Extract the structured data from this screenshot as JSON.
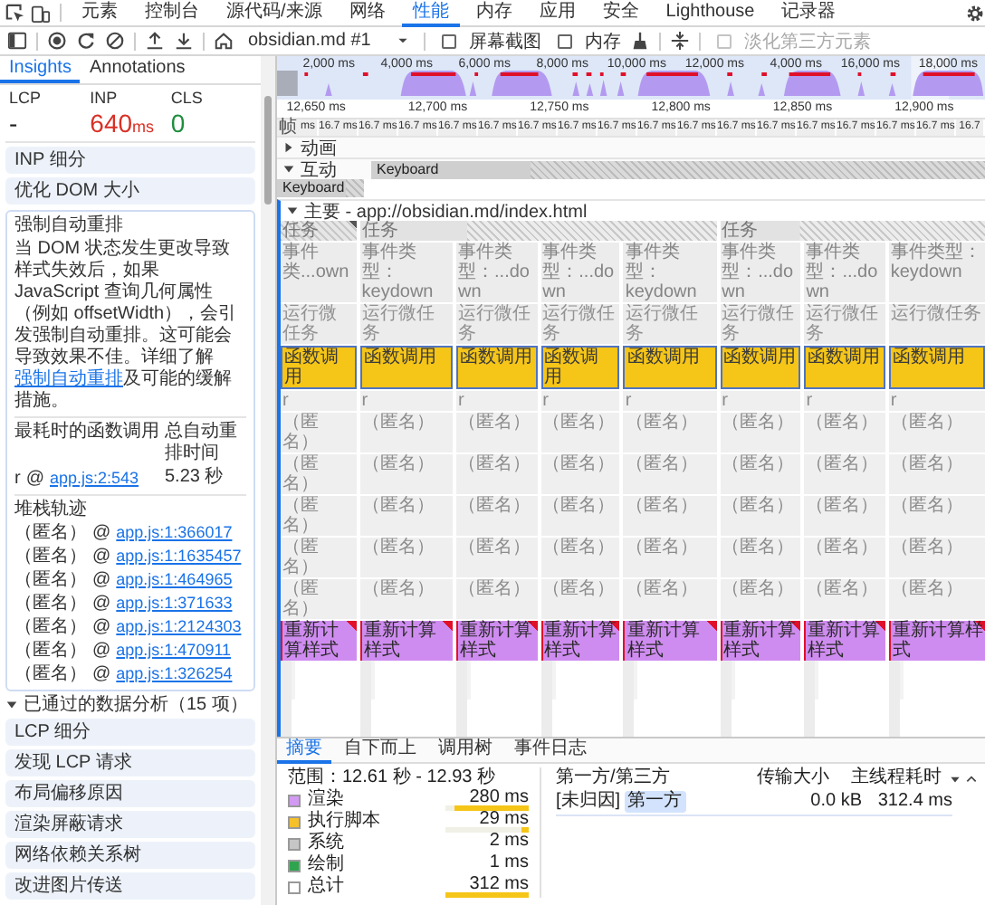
{
  "devtools_tabs": [
    {
      "label": "元素",
      "selected": false
    },
    {
      "label": "控制台",
      "selected": false
    },
    {
      "label": "源代码/来源",
      "selected": false
    },
    {
      "label": "网络",
      "selected": false
    },
    {
      "label": "性能",
      "selected": true
    },
    {
      "label": "内存",
      "selected": false
    },
    {
      "label": "应用",
      "selected": false
    },
    {
      "label": "安全",
      "selected": false
    },
    {
      "label": "Lighthouse",
      "selected": false
    },
    {
      "label": "记录器",
      "selected": false
    }
  ],
  "toolbar": {
    "target": "obsidian.md #1",
    "checkboxes": [
      {
        "label": "屏幕截图",
        "checked": false,
        "disabled": false
      },
      {
        "label": "内存",
        "checked": false,
        "disabled": false
      },
      {
        "label": "淡化第三方元素",
        "checked": false,
        "disabled": true
      }
    ]
  },
  "sidebar": {
    "tabs": [
      {
        "label": "Insights",
        "selected": true
      },
      {
        "label": "Annotations",
        "selected": false
      }
    ],
    "metrics": [
      {
        "name": "LCP",
        "value": "-",
        "color": "#1f1f1f"
      },
      {
        "name": "INP",
        "value": "640",
        "unit": "ms",
        "color": "#d93025"
      },
      {
        "name": "CLS",
        "value": "0",
        "color": "#1e8e3e"
      }
    ],
    "insights": [
      {
        "title": "INP 细分"
      },
      {
        "title": "优化 DOM 大小"
      }
    ],
    "expanded_insight": {
      "title": "强制自动重排",
      "description_before": "当 DOM 状态发生更改导致样式失效后，如果 JavaScript 查询几何属性（例如 offsetWidth），会引发强制自动重排。这可能会导致效果不佳。详细了解",
      "link": "强制自动重排",
      "description_after": "及可能的缓解措施。",
      "columns": [
        "最耗时的函数调用",
        "总自动重排时间"
      ],
      "top_call": {
        "function": "r",
        "at": "@",
        "source": "app.js:2:543",
        "time": "5.23 秒"
      },
      "stack_title": "堆栈轨迹",
      "stack": [
        {
          "function": "（匿名）",
          "at": "@",
          "source": "app.js:1:366017"
        },
        {
          "function": "（匿名）",
          "at": "@",
          "source": "app.js:1:1635457"
        },
        {
          "function": "（匿名）",
          "at": "@",
          "source": "app.js:1:464965"
        },
        {
          "function": "（匿名）",
          "at": "@",
          "source": "app.js:1:371633"
        },
        {
          "function": "（匿名）",
          "at": "@",
          "source": "app.js:1:2124303"
        },
        {
          "function": "（匿名）",
          "at": "@",
          "source": "app.js:1:470911"
        },
        {
          "function": "（匿名）",
          "at": "@",
          "source": "app.js:1:326254"
        }
      ]
    },
    "passed_section": {
      "title": "已通过的数据分析（15 项）",
      "expanded": true,
      "items": [
        {
          "title": "LCP 细分"
        },
        {
          "title": "发现 LCP 请求"
        },
        {
          "title": "布局偏移原因"
        },
        {
          "title": "渲染屏蔽请求"
        },
        {
          "title": "网络依赖关系树"
        },
        {
          "title": "改进图片传送"
        }
      ]
    }
  },
  "timeline": {
    "overview_ticks": [
      "2,000 ms",
      "4,000 ms",
      "6,000 ms",
      "8,000 ms",
      "10,000 ms",
      "12,000 ms",
      "4,000 ms",
      "16,000 ms",
      "18,000 ms"
    ],
    "ruler_ticks": [
      "12,650 ms",
      "12,700 ms",
      "12,750 ms",
      "12,800 ms",
      "12,850 ms",
      "12,900 ms"
    ],
    "frames": {
      "label": "帧",
      "items": [
        "ms",
        "16.7 ms",
        "16.7 ms",
        "16.7 ms",
        "16.7 ms",
        "16.7 ms",
        "16.7 ms",
        "16.7 ms",
        "16.7 ms",
        "16.7 ms",
        "16.7 ms",
        "16.7 ms",
        "16.7 ms",
        "16.7 ms",
        "16.7 ms",
        "16.7 ms",
        "16.7 ms",
        "16.7"
      ]
    },
    "animations": {
      "label": "动画",
      "expanded": false
    },
    "interactions": {
      "label": "互动",
      "expanded": true,
      "items": [
        {
          "label": "Keyboard"
        },
        {
          "label": "Keyboard"
        }
      ]
    },
    "main": {
      "title": "主要 - app://obsidian.md/index.html",
      "expanded": true,
      "tasks": [
        {
          "label": "任务",
          "events": [
            {
              "label": "事件类...own",
              "frames": [
                {
                  "kind": "microtask",
                  "label": "运行微任务"
                },
                {
                  "kind": "function",
                  "label": "函数调用"
                },
                {
                  "kind": "plain",
                  "label": "r"
                },
                {
                  "kind": "plain",
                  "label": "（匿名）"
                },
                {
                  "kind": "plain",
                  "label": "（匿名）"
                },
                {
                  "kind": "plain",
                  "label": "（匿名）"
                },
                {
                  "kind": "plain",
                  "label": "（匿名）"
                },
                {
                  "kind": "plain",
                  "label": "（匿名）"
                },
                {
                  "kind": "style",
                  "label": "重新计算样式"
                }
              ]
            }
          ]
        },
        {
          "label": "任务",
          "events": [
            {
              "label": "事件类型：keydown",
              "frames": [
                {
                  "kind": "microtask",
                  "label": "运行微任务"
                },
                {
                  "kind": "function",
                  "label": "函数调用"
                },
                {
                  "kind": "plain",
                  "label": "r"
                },
                {
                  "kind": "plain",
                  "label": "（匿名）"
                },
                {
                  "kind": "plain",
                  "label": "（匿名）"
                },
                {
                  "kind": "plain",
                  "label": "（匿名）"
                },
                {
                  "kind": "plain",
                  "label": "（匿名）"
                },
                {
                  "kind": "plain",
                  "label": "（匿名）"
                },
                {
                  "kind": "style",
                  "label": "重新计算样式"
                }
              ]
            },
            {
              "label": "事件类型：...down",
              "frames": [
                {
                  "kind": "microtask",
                  "label": "运行微任务"
                },
                {
                  "kind": "function",
                  "label": "函数调用"
                },
                {
                  "kind": "plain",
                  "label": "r"
                },
                {
                  "kind": "plain",
                  "label": "（匿名）"
                },
                {
                  "kind": "plain",
                  "label": "（匿名）"
                },
                {
                  "kind": "plain",
                  "label": "（匿名）"
                },
                {
                  "kind": "plain",
                  "label": "（匿名）"
                },
                {
                  "kind": "plain",
                  "label": "（匿名）"
                },
                {
                  "kind": "style",
                  "label": "重新计算样式"
                }
              ]
            },
            {
              "label": "事件类型：...down",
              "frames": [
                {
                  "kind": "microtask",
                  "label": "运行微任务"
                },
                {
                  "kind": "function",
                  "label": "函数调用"
                },
                {
                  "kind": "plain",
                  "label": "r"
                },
                {
                  "kind": "plain",
                  "label": "（匿名）"
                },
                {
                  "kind": "plain",
                  "label": "（匿名）"
                },
                {
                  "kind": "plain",
                  "label": "（匿名）"
                },
                {
                  "kind": "plain",
                  "label": "（匿名）"
                },
                {
                  "kind": "plain",
                  "label": "（匿名）"
                },
                {
                  "kind": "style",
                  "label": "重新计算样式"
                }
              ]
            },
            {
              "label": "事件类型：keydown",
              "frames": [
                {
                  "kind": "microtask",
                  "label": "运行微任务"
                },
                {
                  "kind": "function",
                  "label": "函数调用"
                },
                {
                  "kind": "plain",
                  "label": "r"
                },
                {
                  "kind": "plain",
                  "label": "（匿名）"
                },
                {
                  "kind": "plain",
                  "label": "（匿名）"
                },
                {
                  "kind": "plain",
                  "label": "（匿名）"
                },
                {
                  "kind": "plain",
                  "label": "（匿名）"
                },
                {
                  "kind": "plain",
                  "label": "（匿名）"
                },
                {
                  "kind": "style",
                  "label": "重新计算样式"
                }
              ]
            }
          ]
        },
        {
          "label": "任务",
          "events": [
            {
              "label": "事件类型：...down",
              "frames": [
                {
                  "kind": "microtask",
                  "label": "运行微任务"
                },
                {
                  "kind": "function",
                  "label": "函数调用"
                },
                {
                  "kind": "plain",
                  "label": "r"
                },
                {
                  "kind": "plain",
                  "label": "（匿名）"
                },
                {
                  "kind": "plain",
                  "label": "（匿名）"
                },
                {
                  "kind": "plain",
                  "label": "（匿名）"
                },
                {
                  "kind": "plain",
                  "label": "（匿名）"
                },
                {
                  "kind": "plain",
                  "label": "（匿名）"
                },
                {
                  "kind": "style",
                  "label": "重新计算样式"
                }
              ]
            },
            {
              "label": "事件类型：...down",
              "frames": [
                {
                  "kind": "microtask",
                  "label": "运行微任务"
                },
                {
                  "kind": "function",
                  "label": "函数调用"
                },
                {
                  "kind": "plain",
                  "label": "r"
                },
                {
                  "kind": "plain",
                  "label": "（匿名）"
                },
                {
                  "kind": "plain",
                  "label": "（匿名）"
                },
                {
                  "kind": "plain",
                  "label": "（匿名）"
                },
                {
                  "kind": "plain",
                  "label": "（匿名）"
                },
                {
                  "kind": "plain",
                  "label": "（匿名）"
                },
                {
                  "kind": "style",
                  "label": "重新计算样式"
                }
              ]
            },
            {
              "label": "事件类型：keydown",
              "frames": [
                {
                  "kind": "microtask",
                  "label": "运行微任务"
                },
                {
                  "kind": "function",
                  "label": "函数调用"
                },
                {
                  "kind": "plain",
                  "label": "r"
                },
                {
                  "kind": "plain",
                  "label": "（匿名）"
                },
                {
                  "kind": "plain",
                  "label": "（匿名）"
                },
                {
                  "kind": "plain",
                  "label": "（匿名）"
                },
                {
                  "kind": "plain",
                  "label": "（匿名）"
                },
                {
                  "kind": "plain",
                  "label": "（匿名）"
                },
                {
                  "kind": "style",
                  "label": "重新计算样式"
                }
              ]
            }
          ]
        }
      ]
    }
  },
  "details": {
    "tabs": [
      {
        "label": "摘要",
        "selected": true
      },
      {
        "label": "自下而上",
        "selected": false
      },
      {
        "label": "调用树",
        "selected": false
      },
      {
        "label": "事件日志",
        "selected": false
      }
    ],
    "range": "范围：12.61 秒 - 12.93 秒",
    "categories": [
      {
        "label": "渲染",
        "value": "280 ms",
        "color": "#d29af2",
        "level": 0.9
      },
      {
        "label": "执行脚本",
        "value": "29 ms",
        "color": "#f5c02a",
        "level": 0.09
      },
      {
        "label": "系统",
        "value": "2 ms",
        "color": "#c6c6c6"
      },
      {
        "label": "绘制",
        "value": "1 ms",
        "color": "#2ea44f"
      },
      {
        "label": "总计",
        "value": "312 ms",
        "color": "#ffffff",
        "level": 1
      }
    ],
    "table": {
      "columns": [
        "第一方/第三方",
        "传输大小",
        "主线程耗时"
      ],
      "rows": [
        {
          "entity": "[未归因]",
          "badge": "第一方",
          "transfer": "0.0 kB",
          "main_thread": "312.4 ms"
        }
      ]
    }
  }
}
